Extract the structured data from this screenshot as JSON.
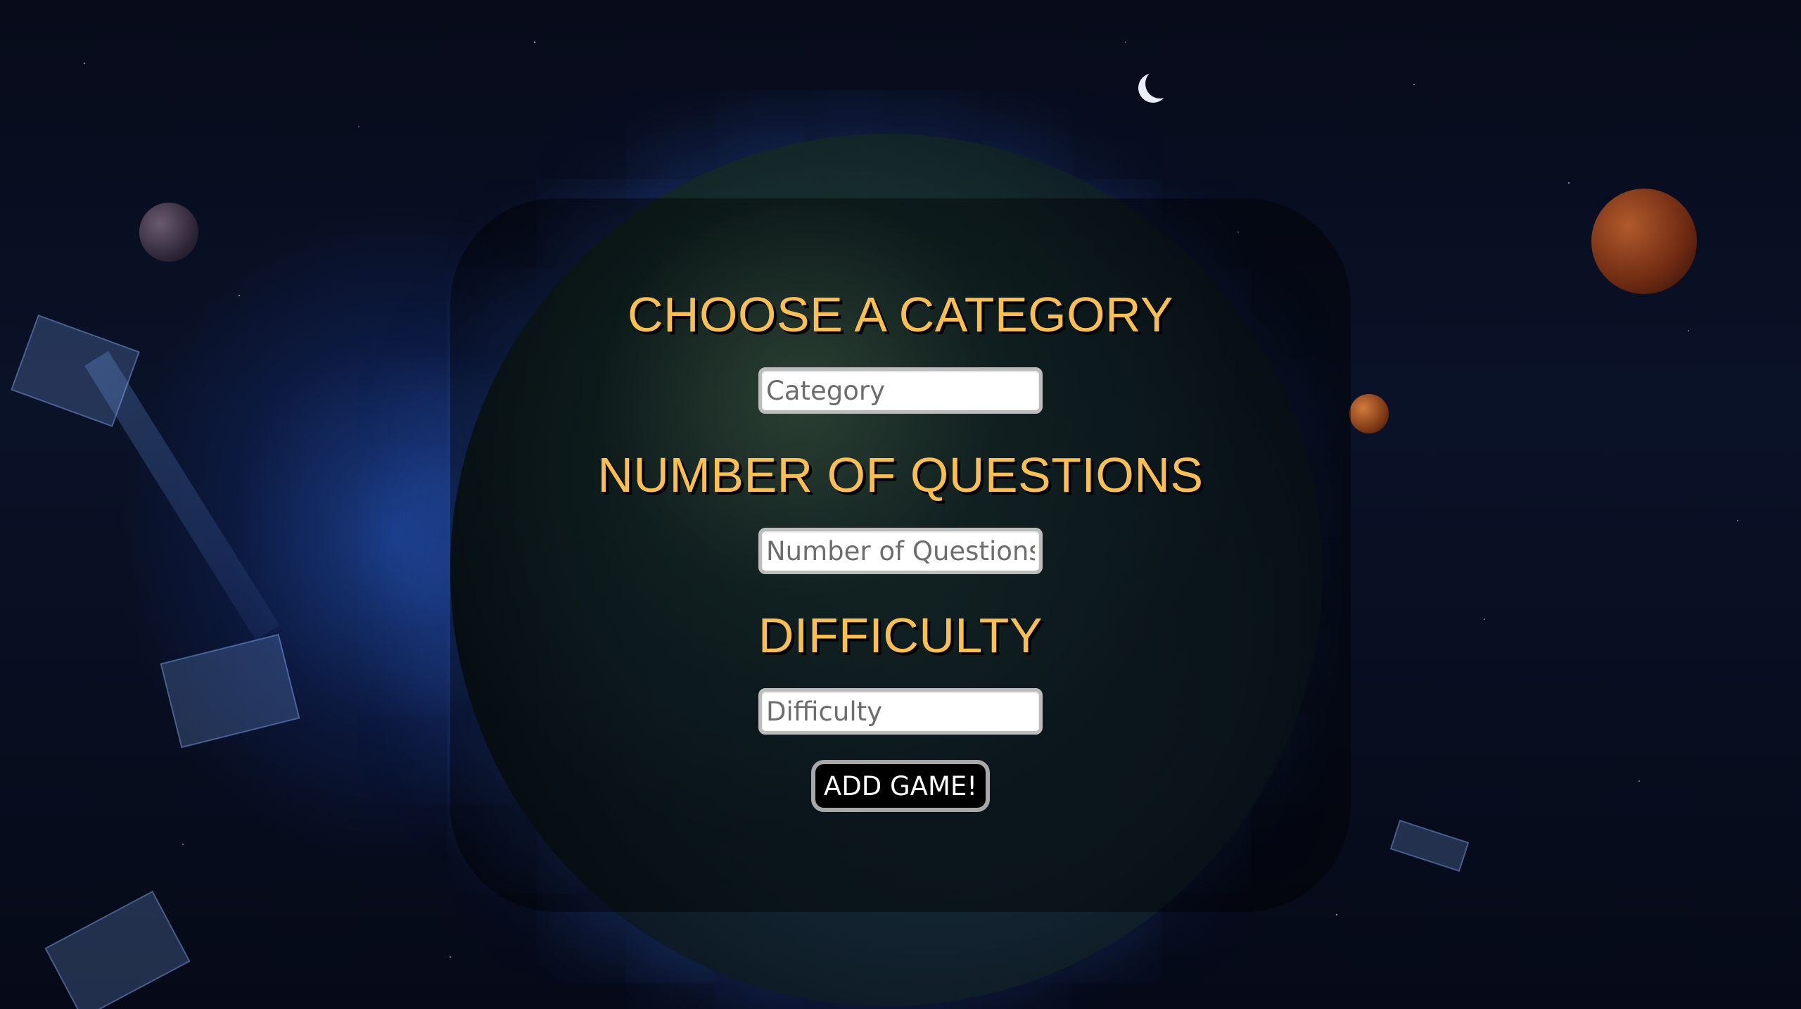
{
  "form": {
    "category_heading": "CHOOSE A CATEGORY",
    "category_placeholder": "Category",
    "category_value": "",
    "questions_heading": "NUMBER OF QUESTIONS",
    "questions_placeholder": "Number of Questions",
    "questions_value": "",
    "difficulty_heading": "DIFFICULTY",
    "difficulty_placeholder": "Difficulty",
    "difficulty_value": "",
    "submit_label": "ADD GAME!"
  },
  "colors": {
    "heading": "#fbbf4f",
    "panel": "rgba(0,0,0,0.42)",
    "button_bg": "#000000",
    "button_text": "#ffffff",
    "field_border": "#bdbdbd"
  },
  "background": {
    "theme": "space-scene-with-planet"
  }
}
